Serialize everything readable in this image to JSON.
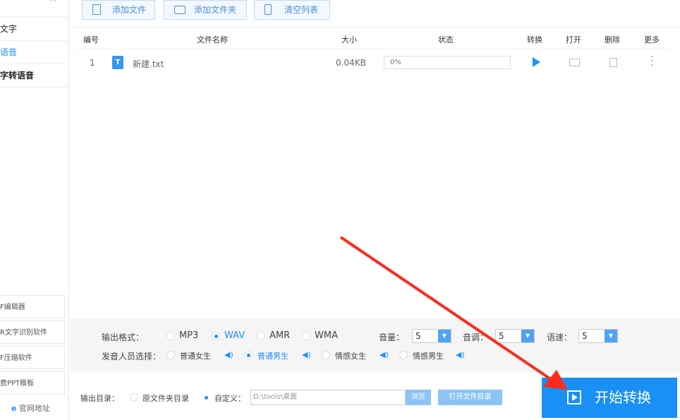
{
  "sidebar": {
    "items": [
      "文字",
      "语音",
      "字转语音"
    ],
    "tools": [
      "F编辑器",
      "R文字识别软件",
      "F压缩软件",
      "费PPT模板"
    ],
    "website": "官网地址"
  },
  "toolbar": {
    "add_file": "添加文件",
    "add_folder": "添加文件夹",
    "clear_list": "清空列表"
  },
  "table": {
    "headers": [
      "编号",
      "文件名称",
      "大小",
      "状态",
      "转换",
      "打开",
      "删除",
      "更多"
    ],
    "rows": [
      {
        "index": "1",
        "name": "新建.txt",
        "size": "0.04KB",
        "progress": "0%"
      }
    ]
  },
  "settings": {
    "format_label": "输出格式：",
    "formats": [
      "MP3",
      "WAV",
      "AMR",
      "WMA"
    ],
    "selected_format": "WAV",
    "volume_label": "音量：",
    "volume": "5",
    "pitch_label": "音调：",
    "pitch": "5",
    "speed_label": "语速：",
    "speed": "5",
    "voice_label": "发音人员选择：",
    "voices": [
      "普通女生",
      "普通男生",
      "情感女生",
      "情感男生"
    ],
    "selected_voice": "普通男生"
  },
  "output": {
    "label": "输出目录：",
    "original": "原文件夹目录",
    "custom": "自定义：",
    "path": "D:\\tools\\桌面",
    "browse": "浏览",
    "open_dir": "打开文件目录"
  },
  "start_button": "开始转换",
  "colors": {
    "accent": "#1e90ff",
    "arrow": "#ff2a1a"
  }
}
